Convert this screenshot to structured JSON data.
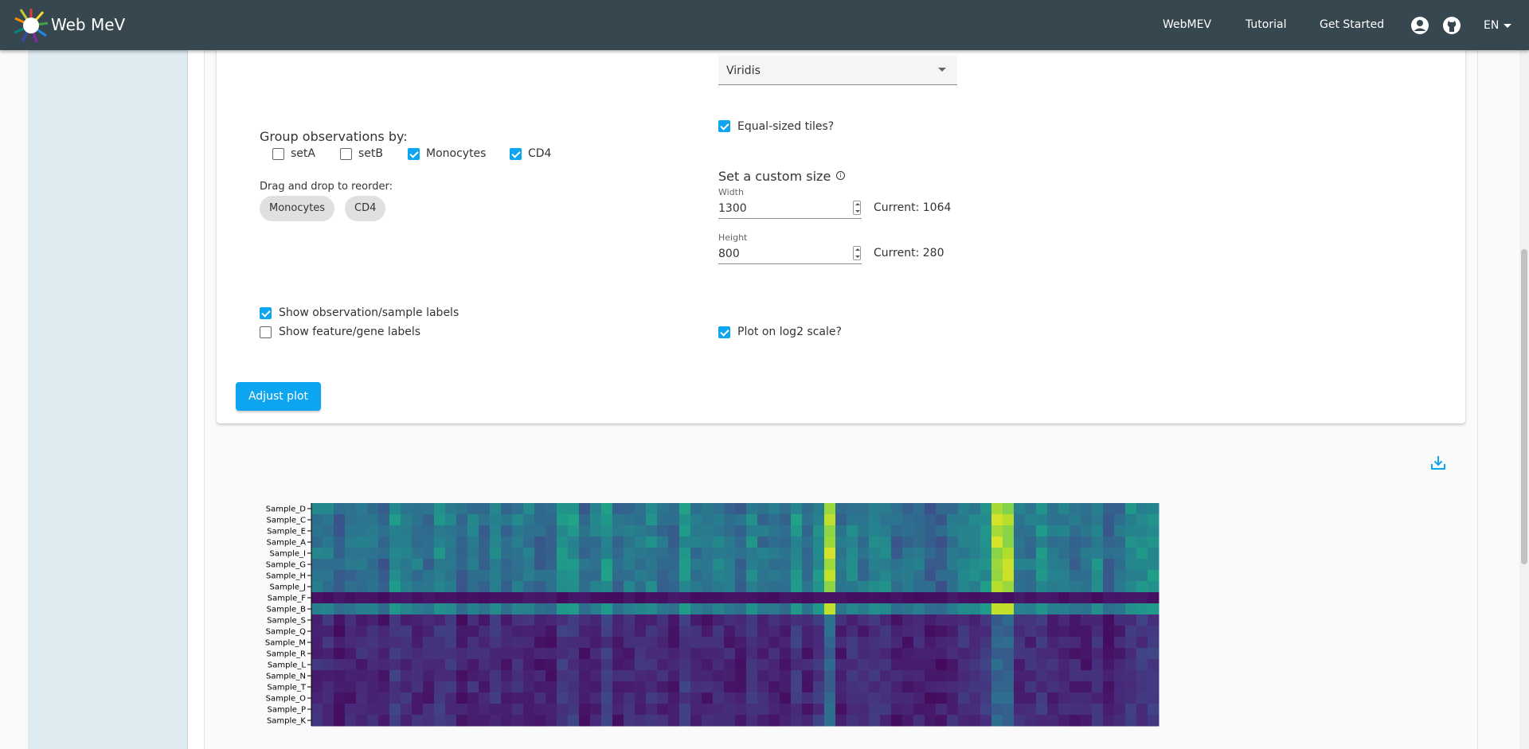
{
  "header": {
    "brand": "Web MeV",
    "nav": [
      "WebMEV",
      "Tutorial",
      "Get Started"
    ],
    "language": "EN",
    "icons": [
      "account-circle-icon",
      "github-icon"
    ]
  },
  "colormap": {
    "selected": "Viridis"
  },
  "group_by": {
    "label": "Group observations by:",
    "options": [
      {
        "label": "setA",
        "checked": false
      },
      {
        "label": "setB",
        "checked": false
      },
      {
        "label": "Monocytes",
        "checked": true
      },
      {
        "label": "CD4",
        "checked": true
      }
    ]
  },
  "reorder": {
    "label": "Drag and drop to reorder:",
    "chips": [
      "Monocytes",
      "CD4"
    ]
  },
  "equal_tiles": {
    "label": "Equal-sized tiles?",
    "checked": true
  },
  "custom_size": {
    "title": "Set a custom size",
    "width": {
      "label": "Width",
      "value": "1300",
      "current": "Current: 1064"
    },
    "height": {
      "label": "Height",
      "value": "800",
      "current": "Current: 280"
    }
  },
  "show_obs_labels": {
    "label": "Show observation/sample labels",
    "checked": true
  },
  "show_gene_labels": {
    "label": "Show feature/gene labels",
    "checked": false
  },
  "log2": {
    "label": "Plot on log2 scale?",
    "checked": true
  },
  "adjust_button": "Adjust plot",
  "colors": {
    "topbar": "#37474f",
    "accent": "#0da4f0",
    "sidebar": "#deebf1"
  },
  "chart_data": {
    "type": "heatmap",
    "colorscale": "viridis",
    "rows": [
      "Sample_D",
      "Sample_C",
      "Sample_E",
      "Sample_A",
      "Sample_I",
      "Sample_G",
      "Sample_H",
      "Sample_J",
      "Sample_F",
      "Sample_B",
      "Sample_S",
      "Sample_Q",
      "Sample_M",
      "Sample_R",
      "Sample_L",
      "Sample_N",
      "Sample_T",
      "Sample_O",
      "Sample_P",
      "Sample_K"
    ],
    "n_columns": 76,
    "high_group_rows": [
      "Sample_D",
      "Sample_C",
      "Sample_E",
      "Sample_A",
      "Sample_I",
      "Sample_G",
      "Sample_H",
      "Sample_J",
      "Sample_B"
    ],
    "low_group_rows": [
      "Sample_F",
      "Sample_S",
      "Sample_Q",
      "Sample_M",
      "Sample_R",
      "Sample_L",
      "Sample_N",
      "Sample_T",
      "Sample_O",
      "Sample_P",
      "Sample_K"
    ],
    "bright_columns": [
      46,
      61,
      62
    ],
    "value_range": [
      0,
      1
    ]
  }
}
